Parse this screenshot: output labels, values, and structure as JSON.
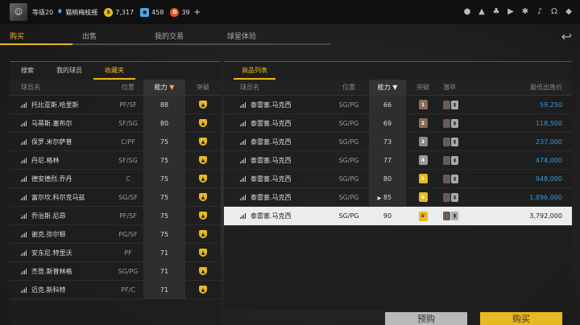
{
  "header": {
    "level": "等级20",
    "player_name": "猫桃梅枝摇",
    "coins": "7,317",
    "points": "458",
    "vouchers": "39",
    "plus": "+"
  },
  "colors": {
    "accent": "#e8b820",
    "price": "#3b9ad6"
  },
  "nav": {
    "tabs": [
      {
        "label": "购买"
      },
      {
        "label": "出售"
      },
      {
        "label": "我的交易"
      },
      {
        "label": "球星体验"
      }
    ]
  },
  "left": {
    "subtabs": [
      {
        "label": "搜索"
      },
      {
        "label": "我的球员"
      },
      {
        "label": "收藏夹"
      }
    ],
    "headers": {
      "name": "球员名",
      "pos": "位置",
      "ability": "能力",
      "break": "突破"
    },
    "rows": [
      {
        "name": "托比亚斯.哈里斯",
        "pos": "PF/SF",
        "ability": "88"
      },
      {
        "name": "马蒂斯.塞布尔",
        "pos": "SF/SG",
        "ability": "80"
      },
      {
        "name": "保罗.米尔萨普",
        "pos": "C/PF",
        "ability": "75"
      },
      {
        "name": "丹尼.格林",
        "pos": "SF/SG",
        "ability": "75"
      },
      {
        "name": "德安德烈.乔丹",
        "pos": "C",
        "ability": "75"
      },
      {
        "name": "富尔坎.科尔克马兹",
        "pos": "SG/SF",
        "ability": "75"
      },
      {
        "name": "乔治斯.尼昂",
        "pos": "PF/SF",
        "ability": "75"
      },
      {
        "name": "谢克.弥尔顿",
        "pos": "PG/SF",
        "ability": "75"
      },
      {
        "name": "安东尼.特里沃",
        "pos": "PF",
        "ability": "71"
      },
      {
        "name": "杰登.斯普林格",
        "pos": "SG/PG",
        "ability": "71"
      },
      {
        "name": "迈克.斯科特",
        "pos": "PF/C",
        "ability": "71"
      }
    ]
  },
  "right": {
    "tab": "商品列表",
    "headers": {
      "name": "球员名",
      "pos": "位置",
      "ability": "能力",
      "break": "突破",
      "cards": "潜卒",
      "price": "最低出售价"
    },
    "rows": [
      {
        "name": "泰雷塞.马克西",
        "pos": "SG/PG",
        "ability": "66",
        "break": "1",
        "break_color": "#8a6a58",
        "price": "59,250"
      },
      {
        "name": "泰雷塞.马克西",
        "pos": "SG/PG",
        "ability": "69",
        "break": "2",
        "break_color": "#8a6a58",
        "price": "118,500"
      },
      {
        "name": "泰雷塞.马克西",
        "pos": "SG/PG",
        "ability": "73",
        "break": "3",
        "break_color": "#888888",
        "price": "237,000"
      },
      {
        "name": "泰雷塞.马克西",
        "pos": "SG/PG",
        "ability": "77",
        "break": "4",
        "break_color": "#9a9a9a",
        "price": "474,000"
      },
      {
        "name": "泰雷塞.马克西",
        "pos": "SG/PG",
        "ability": "80",
        "break": "5",
        "break_color": "#e8b820",
        "price": "948,000"
      },
      {
        "name": "泰雷塞.马克西",
        "pos": "SG/PG",
        "ability": "85",
        "break": "6",
        "break_color": "#e8b820",
        "price": "1,896,000"
      },
      {
        "name": "泰雷塞.马克西",
        "pos": "SG/PG",
        "ability": "90",
        "break": "",
        "break_color": "#e8b820",
        "price": "3,792,000"
      }
    ]
  },
  "buttons": {
    "preorder": "预购",
    "buy": "购买"
  }
}
